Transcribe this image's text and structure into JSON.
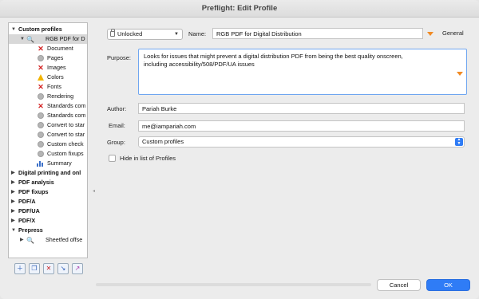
{
  "window": {
    "title": "Preflight: Edit Profile"
  },
  "tree": {
    "custom_profiles": "Custom profiles",
    "selected_profile": "RGB PDF for D",
    "checks": [
      "Document",
      "Pages",
      "Images",
      "Colors",
      "Fonts",
      "Rendering",
      "Standards com",
      "Standards com",
      "Convert to star",
      "Convert to star",
      "Custom check",
      "Custom fixups",
      "Summary"
    ],
    "groups": [
      "Digital printing and onl",
      "PDF analysis",
      "PDF fixups",
      "PDF/A",
      "PDF/UA",
      "PDF/X"
    ],
    "prepress": "Prepress",
    "prepress_child": "Sheetfed offse"
  },
  "form": {
    "lock_state": "Unlocked",
    "name_label": "Name:",
    "name_value": "RGB PDF for Digital Distribution",
    "general_label": "General",
    "purpose_label": "Purpose:",
    "purpose_line1": "Looks for issues that might prevent a digital distribution PDF from being the best quality onscreen,",
    "purpose_line2": "including accessibility/508/PDF/UA issues",
    "author_label": "Author:",
    "author_value": "Pariah Burke",
    "email_label": "Email:",
    "email_value": "me@iampariah.com",
    "group_label": "Group:",
    "group_value": "Custom profiles",
    "hide_label": "Hide in list of Profiles"
  },
  "buttons": {
    "cancel": "Cancel",
    "ok": "OK"
  },
  "colors": {
    "accent": "#2f7cf6",
    "error": "#d32020",
    "warning": "#f2b400",
    "orange": "#f08a24"
  }
}
